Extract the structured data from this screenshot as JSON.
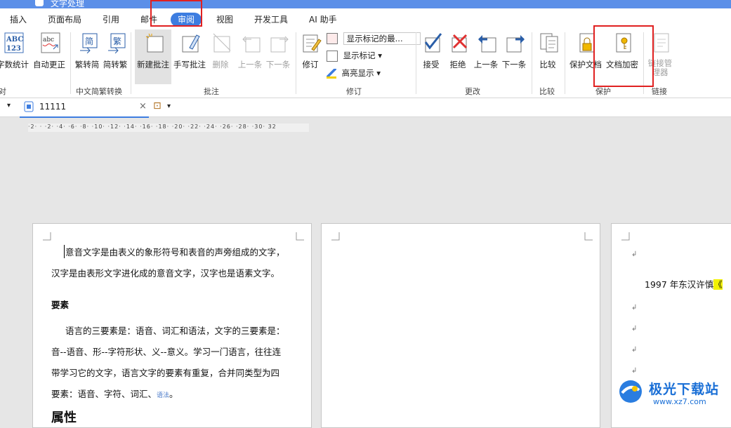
{
  "app": {
    "title": "文字处理"
  },
  "menu_tabs": [
    "插入",
    "页面布局",
    "引用",
    "邮件",
    "审阅",
    "视图",
    "开发工具",
    "AI 助手"
  ],
  "active_tab": "审阅",
  "ribbon": {
    "word_count": "字数统计",
    "auto_correct": "自动更正",
    "to_simplified": "繁转简",
    "to_traditional": "简转繁",
    "group_conversion": "中文简繁转换",
    "new_comment": "新建批注",
    "handwrite_comment": "手写批注",
    "delete": "删除",
    "prev_comment": "上一条",
    "next_comment": "下一条",
    "group_comment": "批注",
    "track_changes": "修订",
    "display_mode_select": "显示标记的最...",
    "show_markup": "显示标记",
    "highlight_display": "高亮显示",
    "group_revision": "修订",
    "accept": "接受",
    "reject": "拒绝",
    "prev_change": "上一条",
    "next_change": "下一条",
    "group_changes": "更改",
    "compare": "比较",
    "group_compare": "比较",
    "protect_doc": "保护文档",
    "encrypt_doc": "文档加密",
    "group_protect": "保护",
    "link_manager": "链接管理器",
    "group_link": "链接",
    "left_group_fragment": "对"
  },
  "document_tab": {
    "name": "11111"
  },
  "ruler": {
    "ticks": "·2·  ·  ·2· ·4· ·6· ·8· ·10· ·12· ·14· ·16· ·18· ·20· ·22· ·24· ·26· ·28· ·30·  32"
  },
  "page1": {
    "line1": "意音文字是由表义的象形符号和表音的声旁组成的文字，",
    "line2": "汉字是由表形文字进化成的意音文字，汉字也是语素文字。",
    "heading": "要素",
    "line3": "语言的三要素是：语音、词汇和语法，文字的三要素是：",
    "line4": "音--语音、形--字符形状、义--意义。学习一门语言，往往连",
    "line5": "带学习它的文字，语言文字的要素有重复，合并同类型为四",
    "line6_a": "要素：语音、字符、词汇、",
    "line6_b": "语法",
    "line6_c": "。",
    "line7": "属性"
  },
  "page3": {
    "line1": "1997 年东汉许慎",
    "highlight_mark": "《"
  },
  "watermark": {
    "title": "极光下载站",
    "url": "www.xz7.com"
  },
  "colors": {
    "accent": "#3d7de0",
    "annotation_red": "#e02020",
    "highlight": "#f2f200"
  }
}
